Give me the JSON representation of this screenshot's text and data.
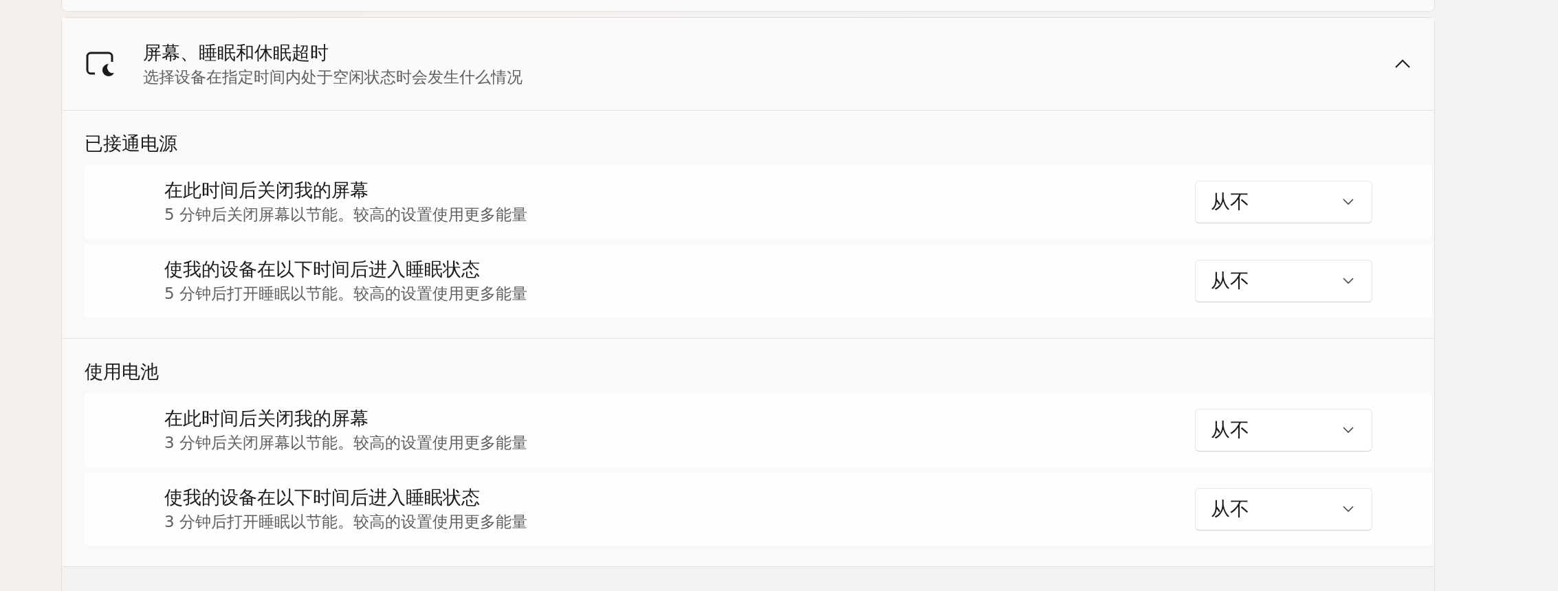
{
  "group": {
    "title": "屏幕、睡眠和休眠超时",
    "description": "选择设备在指定时间内处于空闲状态时会发生什么情况",
    "expanded": true
  },
  "sections": [
    {
      "label": "已接通电源",
      "rows": [
        {
          "title": "在此时间后关闭我的屏幕",
          "description": "5 分钟后关闭屏幕以节能。较高的设置使用更多能量",
          "value": "从不"
        },
        {
          "title": "使我的设备在以下时间后进入睡眠状态",
          "description": "5 分钟后打开睡眠以节能。较高的设置使用更多能量",
          "value": "从不"
        }
      ]
    },
    {
      "label": "使用电池",
      "rows": [
        {
          "title": "在此时间后关闭我的屏幕",
          "description": "3 分钟后关闭屏幕以节能。较高的设置使用更多能量",
          "value": "从不"
        },
        {
          "title": "使我的设备在以下时间后进入睡眠状态",
          "description": "3 分钟后打开睡眠以节能。较高的设置使用更多能量",
          "value": "从不"
        }
      ]
    }
  ]
}
